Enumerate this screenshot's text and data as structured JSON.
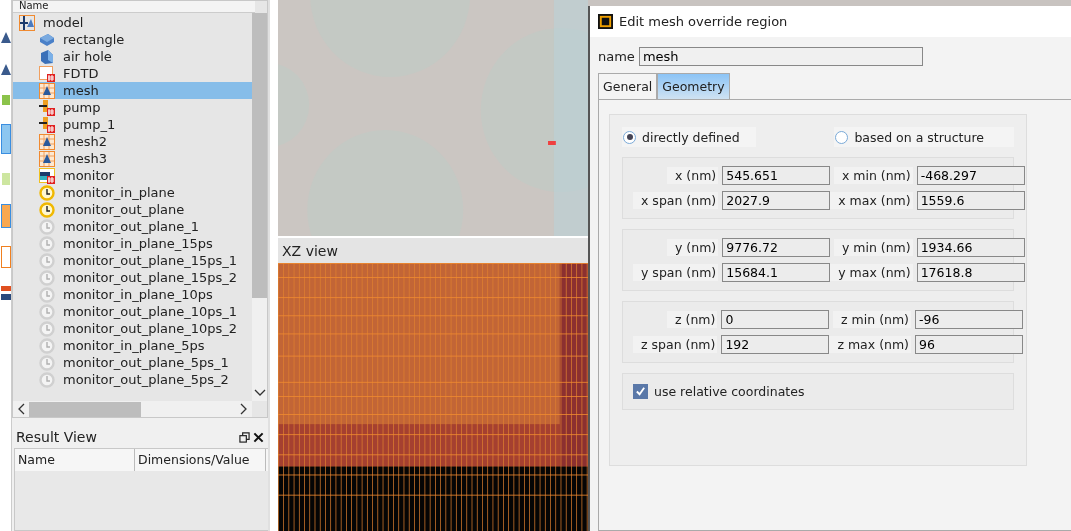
{
  "object_tree": {
    "header": "Name",
    "items": [
      {
        "label": "model",
        "kind": "model",
        "selected": false,
        "children": [
          {
            "label": "rectangle",
            "kind": "rectangle",
            "selected": false
          },
          {
            "label": "air hole",
            "kind": "hole",
            "selected": false
          },
          {
            "label": "FDTD",
            "kind": "fdtd",
            "selected": false
          },
          {
            "label": "mesh",
            "kind": "mesh",
            "selected": true
          },
          {
            "label": "pump",
            "kind": "source",
            "selected": false
          },
          {
            "label": "pump_1",
            "kind": "source",
            "selected": false
          },
          {
            "label": "mesh2",
            "kind": "mesh",
            "selected": false
          },
          {
            "label": "mesh3",
            "kind": "mesh",
            "selected": false
          },
          {
            "label": "monitor",
            "kind": "monitor",
            "selected": false
          },
          {
            "label": "monitor_in_plane",
            "kind": "time",
            "selected": false,
            "enabled": true
          },
          {
            "label": "monitor_out_plane",
            "kind": "time",
            "selected": false,
            "enabled": true
          },
          {
            "label": "monitor_out_plane_1",
            "kind": "time",
            "selected": false,
            "enabled": false
          },
          {
            "label": "monitor_in_plane_15ps",
            "kind": "time",
            "selected": false,
            "enabled": false
          },
          {
            "label": "monitor_out_plane_15ps_1",
            "kind": "time",
            "selected": false,
            "enabled": false
          },
          {
            "label": "monitor_out_plane_15ps_2",
            "kind": "time",
            "selected": false,
            "enabled": false
          },
          {
            "label": "monitor_in_plane_10ps",
            "kind": "time",
            "selected": false,
            "enabled": false
          },
          {
            "label": "monitor_out_plane_10ps_1",
            "kind": "time",
            "selected": false,
            "enabled": false
          },
          {
            "label": "monitor_out_plane_10ps_2",
            "kind": "time",
            "selected": false,
            "enabled": false
          },
          {
            "label": "monitor_in_plane_5ps",
            "kind": "time",
            "selected": false,
            "enabled": false
          },
          {
            "label": "monitor_out_plane_5ps_1",
            "kind": "time",
            "selected": false,
            "enabled": false
          },
          {
            "label": "monitor_out_plane_5ps_2",
            "kind": "time",
            "selected": false,
            "enabled": false
          }
        ]
      }
    ]
  },
  "result_view": {
    "title": "Result View",
    "columns": [
      "Name",
      "Dimensions/Value"
    ]
  },
  "xz_view": {
    "title": "XZ view"
  },
  "dialog": {
    "title": "Edit mesh override region",
    "name_label": "name",
    "name_value": "mesh",
    "tabs": [
      {
        "label": "General",
        "selected": false
      },
      {
        "label": "Geometry",
        "selected": true
      }
    ],
    "options": [
      {
        "label": "directly defined",
        "selected": true
      },
      {
        "label": "based on a structure",
        "selected": false
      }
    ],
    "groups": [
      [
        {
          "label": "x (nm)",
          "value": "545.651"
        },
        {
          "label": "x min (nm)",
          "value": "-468.297"
        },
        {
          "label": "x span (nm)",
          "value": "2027.9"
        },
        {
          "label": "x max (nm)",
          "value": "1559.6"
        }
      ],
      [
        {
          "label": "y (nm)",
          "value": "9776.72"
        },
        {
          "label": "y min (nm)",
          "value": "1934.66"
        },
        {
          "label": "y span (nm)",
          "value": "15684.1"
        },
        {
          "label": "y max (nm)",
          "value": "17618.8"
        }
      ],
      [
        {
          "label": "z (nm)",
          "value": "0"
        },
        {
          "label": "z min (nm)",
          "value": "-96"
        },
        {
          "label": "z span (nm)",
          "value": "192"
        },
        {
          "label": "z max (nm)",
          "value": "96"
        }
      ]
    ],
    "relative": {
      "label": "use relative coordinates",
      "checked": true
    }
  }
}
